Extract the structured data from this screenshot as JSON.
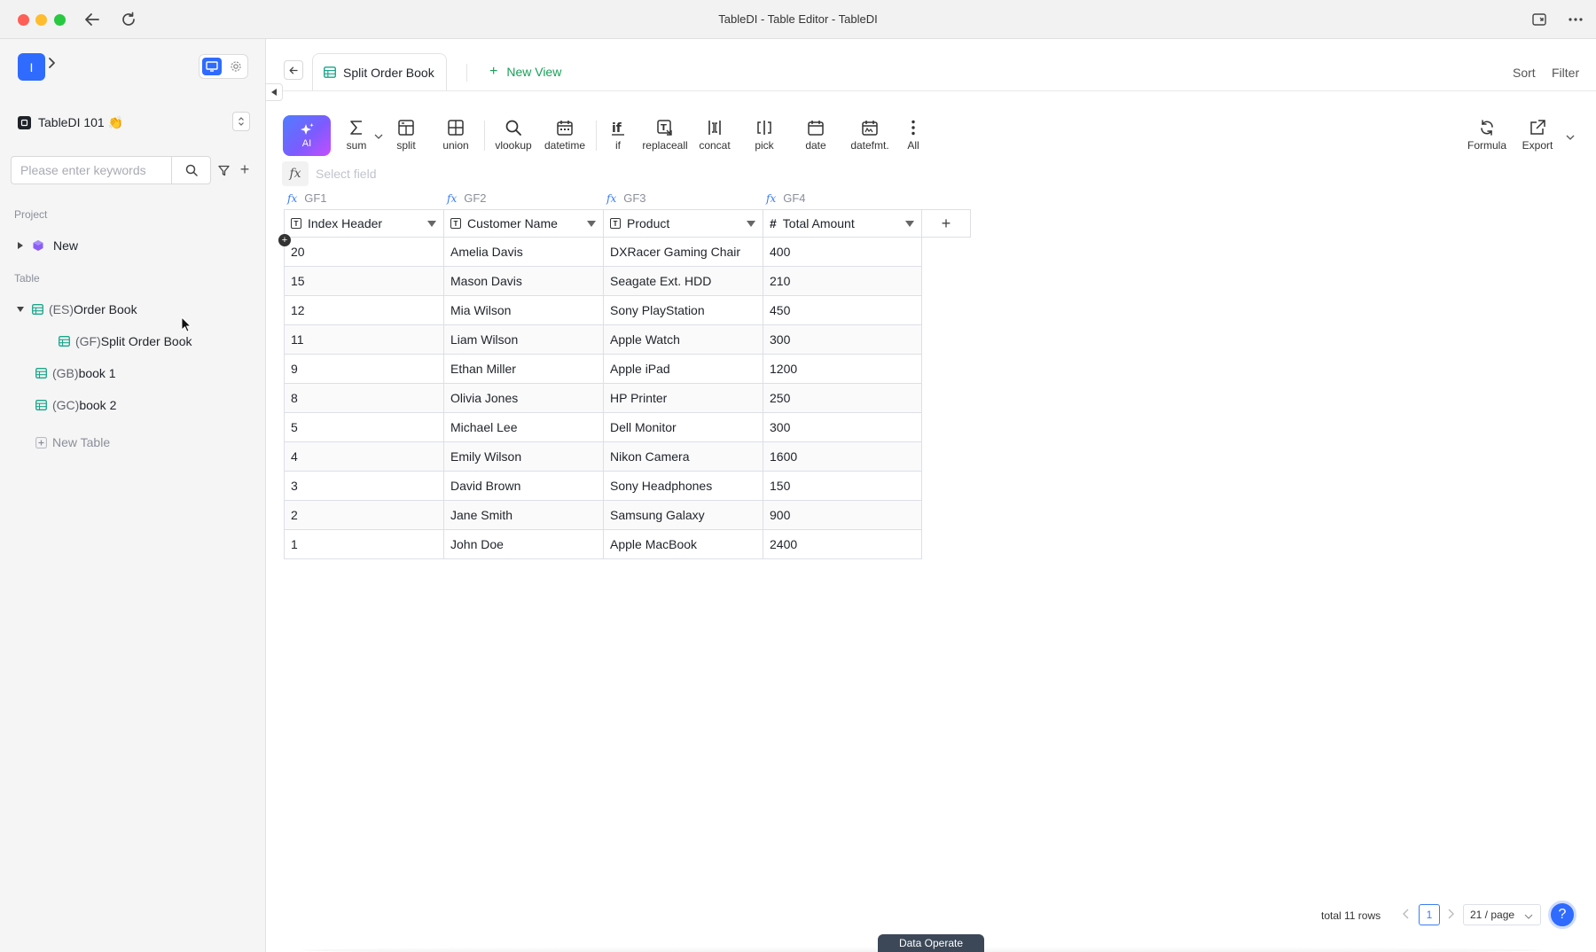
{
  "window": {
    "title": "TableDI - Table Editor - TableDI"
  },
  "sidebar": {
    "app_badge": "I",
    "workspace_name": "TableDI 101 👏",
    "search_placeholder": "Please enter keywords",
    "project_label": "Project",
    "project_items": [
      {
        "label": "New"
      }
    ],
    "table_label": "Table",
    "tables": [
      {
        "prefix": "(ES)",
        "name": "Order Book",
        "expanded": true
      },
      {
        "prefix": "(GF)",
        "name": "Split Order Book",
        "child": true
      },
      {
        "prefix": "(GB)",
        "name": "book 1"
      },
      {
        "prefix": "(GC)",
        "name": "book 2"
      }
    ],
    "new_table_label": "New Table"
  },
  "main": {
    "tab_label": "Split Order Book",
    "new_view_label": "New View",
    "sort_label": "Sort",
    "filter_label": "Filter",
    "toolbar": {
      "ai_label": "AI",
      "tools": [
        "sum",
        "split",
        "union",
        "vlookup",
        "datetime",
        "if",
        "replaceall",
        "concat",
        "pick",
        "date",
        "datefmt.",
        "All"
      ],
      "formula_label": "Formula",
      "export_label": "Export"
    },
    "formula_bar": {
      "fx_label": "fx",
      "placeholder": "Select field"
    },
    "column_codes": [
      "GF1",
      "GF2",
      "GF3",
      "GF4"
    ],
    "columns": [
      {
        "name": "Index Header",
        "type": "text"
      },
      {
        "name": "Customer Name",
        "type": "text"
      },
      {
        "name": "Product",
        "type": "text"
      },
      {
        "name": "Total Amount",
        "type": "number"
      }
    ],
    "rows": [
      [
        "20",
        "Amelia Davis",
        "DXRacer Gaming Chair",
        "400"
      ],
      [
        "15",
        "Mason Davis",
        "Seagate Ext. HDD",
        "210"
      ],
      [
        "12",
        "Mia Wilson",
        "Sony PlayStation",
        "450"
      ],
      [
        "11",
        "Liam Wilson",
        "Apple Watch",
        "300"
      ],
      [
        "9",
        "Ethan Miller",
        "Apple iPad",
        "1200"
      ],
      [
        "8",
        "Olivia Jones",
        "HP Printer",
        "250"
      ],
      [
        "5",
        "Michael Lee",
        "Dell Monitor",
        "300"
      ],
      [
        "4",
        "Emily Wilson",
        "Nikon Camera",
        "1600"
      ],
      [
        "3",
        "David Brown",
        "Sony Headphones",
        "150"
      ],
      [
        "2",
        "Jane Smith",
        "Samsung Galaxy",
        "900"
      ],
      [
        "1",
        "John Doe",
        "Apple MacBook",
        "2400"
      ]
    ],
    "footer": {
      "total": "total 11 rows",
      "current_page": "1",
      "page_size": "21 / page",
      "help": "?"
    },
    "data_operate_label": "Data Operate"
  },
  "colors": {
    "accent_blue": "#2f6bff",
    "new_view_green": "#18a058",
    "table_icon_teal": "#1aa58a"
  }
}
